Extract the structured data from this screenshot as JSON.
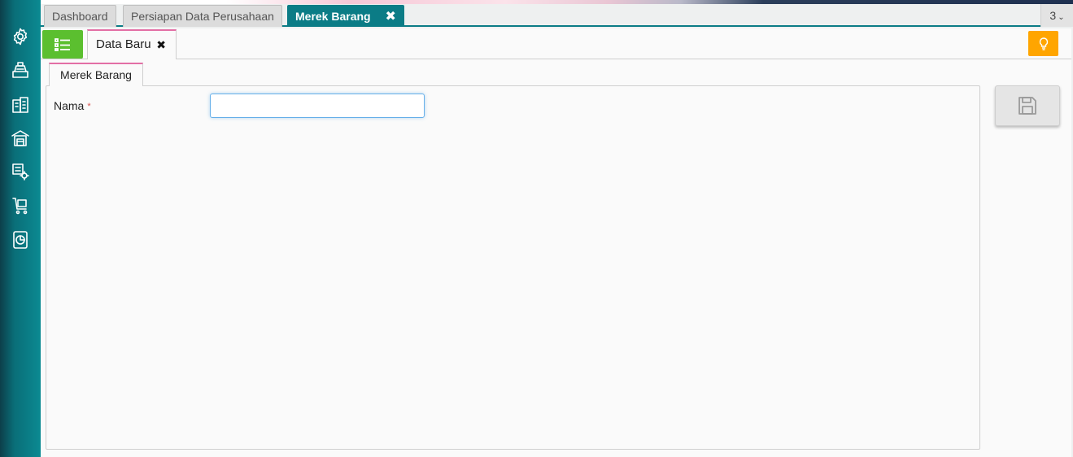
{
  "tabs": [
    {
      "label": "Dashboard",
      "active": false
    },
    {
      "label": "Persiapan Data Perusahaan",
      "active": false
    },
    {
      "label": "Merek Barang",
      "active": true
    }
  ],
  "tab_count": "3",
  "subtab": {
    "label": "Data Baru"
  },
  "form_tab": {
    "label": "Merek Barang"
  },
  "form": {
    "fields": [
      {
        "label": "Nama",
        "required_mark": "*",
        "value": "",
        "placeholder": ""
      }
    ]
  },
  "sidebar": {
    "icons": [
      "gear-icon",
      "cash-register-icon",
      "building-icon",
      "warehouse-icon",
      "gear-process-icon",
      "cart-icon",
      "report-icon"
    ]
  },
  "colors": {
    "accent": "#0b7c86",
    "list_button": "#5bbf2f",
    "bulb_button": "#ffa500",
    "subtab_border": "#e36fa5"
  }
}
